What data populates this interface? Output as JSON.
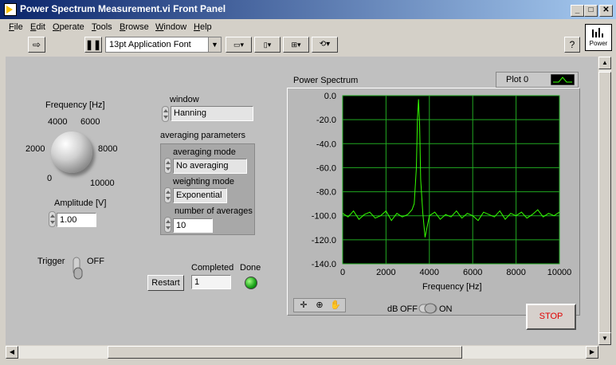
{
  "window": {
    "title": "Power Spectrum Measurement.vi Front Panel",
    "minimize": "_",
    "maximize": "□",
    "close": "✕"
  },
  "menu": [
    {
      "label": "File",
      "accel": "F",
      "rest": "ile"
    },
    {
      "label": "Edit",
      "accel": "E",
      "rest": "dit"
    },
    {
      "label": "Operate",
      "accel": "O",
      "rest": "perate"
    },
    {
      "label": "Tools",
      "accel": "T",
      "rest": "ools"
    },
    {
      "label": "Browse",
      "accel": "B",
      "rest": "rowse"
    },
    {
      "label": "Window",
      "accel": "W",
      "rest": "indow"
    },
    {
      "label": "Help",
      "accel": "H",
      "rest": "elp"
    }
  ],
  "toolbar": {
    "font": "13pt Application Font",
    "help": "?",
    "vi_icon_label": "Power"
  },
  "frequency": {
    "label": "Frequency [Hz]",
    "scale": [
      "0",
      "2000",
      "4000",
      "6000",
      "8000",
      "10000"
    ]
  },
  "amplitude": {
    "label": "Amplitude [V]",
    "value": "1.00"
  },
  "trigger": {
    "label": "Trigger",
    "state": "OFF"
  },
  "window_ctrl": {
    "label": "window",
    "value": "Hanning"
  },
  "averaging": {
    "label": "averaging parameters",
    "mode_label": "averaging mode",
    "mode_value": "No averaging",
    "weighting_label": "weighting mode",
    "weighting_value": "Exponential",
    "count_label": "number of averages",
    "count_value": "10"
  },
  "restart": {
    "label": "Restart"
  },
  "completed": {
    "label": "Completed",
    "value": "1"
  },
  "done": {
    "label": "Done",
    "state": "on"
  },
  "graph": {
    "title": "Power Spectrum",
    "legend": "Plot 0",
    "xlabel": "Frequency [Hz]",
    "xticks": [
      "0",
      "2000",
      "4000",
      "6000",
      "8000",
      "10000"
    ],
    "yticks": [
      "0.0",
      "-20.0",
      "-40.0",
      "-60.0",
      "-80.0",
      "-100.0",
      "-120.0",
      "-140.0"
    ],
    "trace_color": "#33ff00",
    "plot_bg": "#000000",
    "grid_color": "#21a821"
  },
  "db_switch": {
    "label": "dB",
    "off": "OFF",
    "on": "ON",
    "state": "ON"
  },
  "stop": {
    "label": "STOP"
  },
  "chart_data": {
    "type": "line",
    "title": "Power Spectrum",
    "xlabel": "Frequency [Hz]",
    "ylabel": "",
    "xlim": [
      0,
      10000
    ],
    "ylim": [
      -140,
      0
    ],
    "series": [
      {
        "name": "Plot 0",
        "x": [
          0,
          250,
          500,
          750,
          1000,
          1250,
          1500,
          1750,
          2000,
          2250,
          2500,
          2750,
          3000,
          3200,
          3300,
          3400,
          3450,
          3500,
          3550,
          3600,
          3700,
          3800,
          4000,
          4250,
          4500,
          4750,
          5000,
          5250,
          5500,
          5750,
          6000,
          6250,
          6500,
          6750,
          7000,
          7250,
          7500,
          7750,
          8000,
          8250,
          8500,
          8750,
          9000,
          9250,
          9500,
          9750,
          10000
        ],
        "y": [
          -98,
          -101,
          -96,
          -103,
          -99,
          -97,
          -102,
          -100,
          -96,
          -104,
          -98,
          -101,
          -99,
          -95,
          -90,
          -60,
          -20,
          -3,
          -25,
          -70,
          -98,
          -118,
          -100,
          -97,
          -103,
          -99,
          -101,
          -96,
          -102,
          -98,
          -100,
          -104,
          -97,
          -99,
          -101,
          -96,
          -103,
          -98,
          -100,
          -97,
          -102,
          -99,
          -95,
          -101,
          -98,
          -100,
          -97
        ]
      }
    ]
  }
}
